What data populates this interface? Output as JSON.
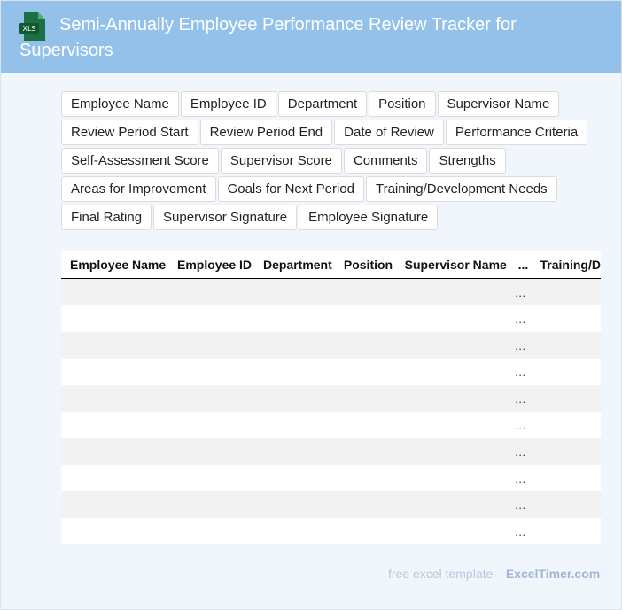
{
  "header": {
    "title": "Semi-Annually Employee Performance Review Tracker for Supervisors",
    "icon": "excel-file-icon",
    "icon_label": "XLS"
  },
  "fields": [
    "Employee Name",
    "Employee ID",
    "Department",
    "Position",
    "Supervisor Name",
    "Review Period Start",
    "Review Period End",
    "Date of Review",
    "Performance Criteria",
    "Self-Assessment Score",
    "Supervisor Score",
    "Comments",
    "Strengths",
    "Areas for Improvement",
    "Goals for Next Period",
    "Training/Development Needs",
    "Final Rating",
    "Supervisor Signature",
    "Employee Signature"
  ],
  "table": {
    "columns": [
      "Employee Name",
      "Employee ID",
      "Department",
      "Position",
      "Supervisor Name",
      "...",
      "Training/D"
    ],
    "row_count": 10,
    "ellipsis": "…"
  },
  "footer": {
    "prefix": "free excel template -",
    "brand": "ExcelTimer.com"
  },
  "colors": {
    "header_bg": "#93c1ea",
    "page_bg": "#f1f6fc",
    "stripe": "#f2f2f2",
    "excel_green": "#1d7044"
  }
}
